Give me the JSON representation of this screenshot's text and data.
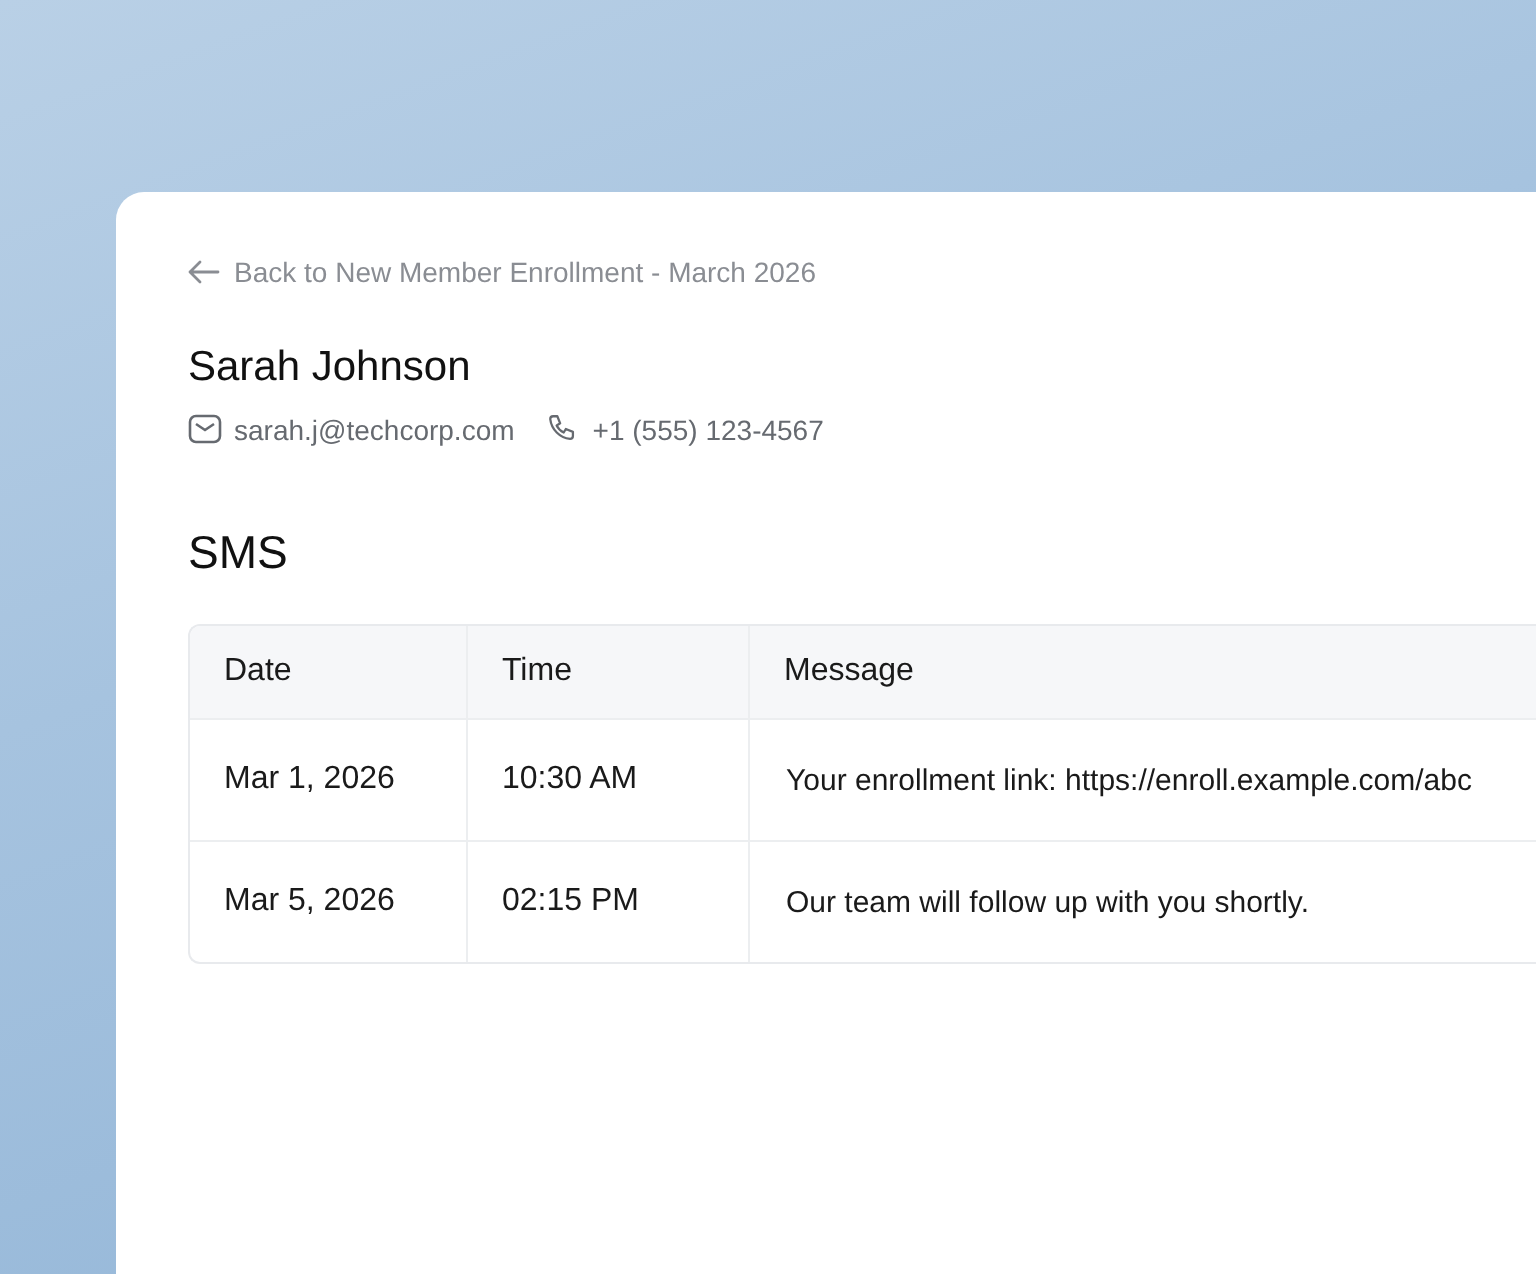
{
  "back_link": {
    "label": "Back to New Member Enrollment - March 2026"
  },
  "contact": {
    "name": "Sarah Johnson",
    "email": "sarah.j@techcorp.com",
    "phone": "+1 (555) 123-4567"
  },
  "section_title": "SMS",
  "table": {
    "columns": [
      "Date",
      "Time",
      "Message"
    ],
    "rows": [
      [
        "Mar 1, 2026",
        "10:30 AM",
        "Your enrollment link: https://enroll.example.com/abc"
      ],
      [
        "Mar 5, 2026",
        "02:15 PM",
        "Our team will follow up with you shortly."
      ]
    ]
  }
}
